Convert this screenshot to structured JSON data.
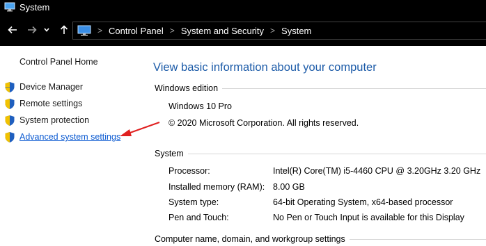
{
  "window": {
    "title": "System"
  },
  "address_bar": {
    "crumbs": [
      "Control Panel",
      "System and Security",
      "System"
    ]
  },
  "sidebar": {
    "home": "Control Panel Home",
    "items": [
      {
        "label": "Device Manager"
      },
      {
        "label": "Remote settings"
      },
      {
        "label": "System protection"
      },
      {
        "label": "Advanced system settings"
      }
    ]
  },
  "main": {
    "heading": "View basic information about your computer",
    "windows_edition": {
      "section": "Windows edition",
      "edition": "Windows 10 Pro",
      "copyright": "© 2020 Microsoft Corporation. All rights reserved."
    },
    "system": {
      "section": "System",
      "rows": [
        {
          "label": "Processor:",
          "value": "Intel(R) Core(TM) i5-4460  CPU @ 3.20GHz   3.20 GHz"
        },
        {
          "label": "Installed memory (RAM):",
          "value": "8.00 GB"
        },
        {
          "label": "System type:",
          "value": "64-bit Operating System, x64-based processor"
        },
        {
          "label": "Pen and Touch:",
          "value": "No Pen or Touch Input is available for this Display"
        }
      ]
    },
    "computer_name": {
      "section": "Computer name, domain, and workgroup settings"
    }
  },
  "colors": {
    "link": "#0b5ad1",
    "heading": "#1c5ba8",
    "annotation_arrow": "#e02020"
  }
}
